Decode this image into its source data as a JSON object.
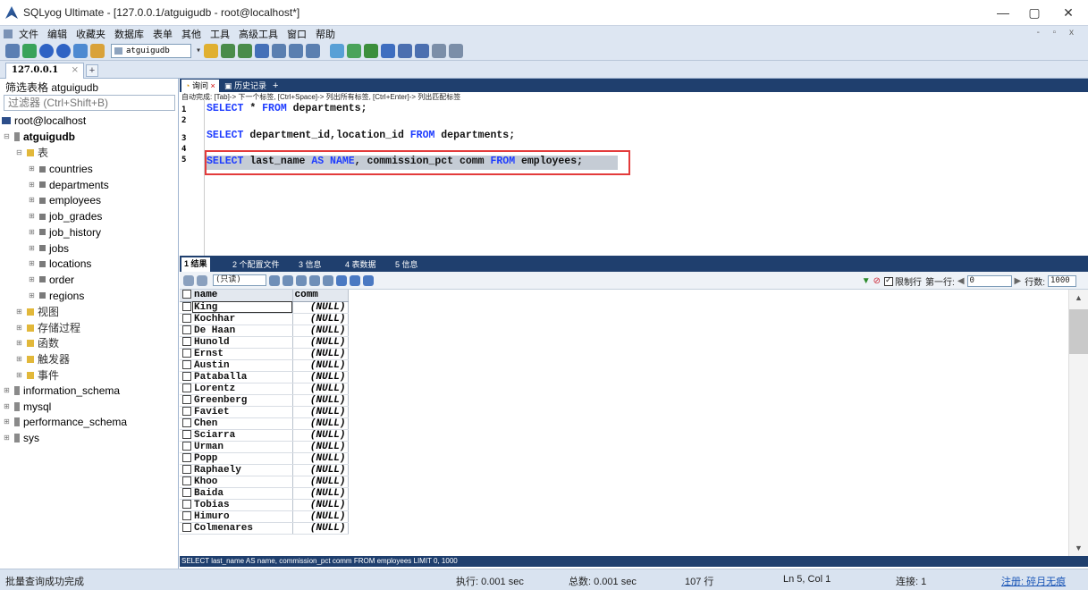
{
  "window": {
    "title": "SQLyog Ultimate - [127.0.0.1/atguigudb - root@localhost*]",
    "min_glyph": "—",
    "max_glyph": "▢",
    "close_glyph": "✕",
    "mdi_controls": "- ▫ x"
  },
  "menu": [
    "文件",
    "编辑",
    "收藏夹",
    "数据库",
    "表单",
    "其他",
    "工具",
    "高级工具",
    "窗口",
    "帮助"
  ],
  "toolbar": {
    "db_select": "atguigudb"
  },
  "connection_tab": {
    "label": "127.0.0.1",
    "close": "×",
    "add": "+"
  },
  "left": {
    "filter_label": "筛选表格 atguigudb",
    "filter_placeholder": "过滤器 (Ctrl+Shift+B)",
    "host": "root@localhost",
    "db": "atguigudb",
    "tables_folder": "表",
    "tables": [
      "countries",
      "departments",
      "employees",
      "job_grades",
      "job_history",
      "jobs",
      "locations",
      "order",
      "regions"
    ],
    "folders": [
      "视图",
      "存储过程",
      "函数",
      "触发器",
      "事件"
    ],
    "other_dbs": [
      "information_schema",
      "mysql",
      "performance_schema",
      "sys"
    ]
  },
  "editor": {
    "tab_query": "询问",
    "tab_history": "历史记录",
    "add_tab": "+",
    "autocomplete_hint": "自动完成: [Tab]-> 下一个标签, [Ctrl+Space]-> 列出所有标签, [Ctrl+Enter]-> 列出匹配标签",
    "line_numbers": [
      "1",
      "2",
      "3",
      "4",
      "5"
    ],
    "line1": {
      "a": "SELECT",
      "b": " * ",
      "c": "FROM",
      "d": " departments;"
    },
    "line3": {
      "a": "SELECT",
      "b": " department_id,location_id ",
      "c": "FROM",
      "d": " departments;"
    },
    "line5": {
      "a": "SELECT",
      "b": " last_name ",
      "c": "AS NAME",
      "d": ", commission_pct comm ",
      "e": "FROM",
      "f": " employees;"
    }
  },
  "result_tabs": [
    "1 结果",
    "2 个配置文件",
    "3 信息",
    "4 表数据",
    "5 信息"
  ],
  "result_toolbar": {
    "readonly": "(只读)",
    "limit_label": "限制行",
    "first_row_label": "第一行:",
    "first_row_value": "0",
    "rows_label": "行数:",
    "rows_value": "1000"
  },
  "grid": {
    "columns": [
      "name",
      "comm"
    ],
    "null_text": "(NULL)",
    "rows": [
      "King",
      "Kochhar",
      "De Haan",
      "Hunold",
      "Ernst",
      "Austin",
      "Pataballa",
      "Lorentz",
      "Greenberg",
      "Faviet",
      "Chen",
      "Sciarra",
      "Urman",
      "Popp",
      "Raphaely",
      "Khoo",
      "Baida",
      "Tobias",
      "Himuro",
      "Colmenares"
    ]
  },
  "sql_status": "SELECT last_name AS name, commission_pct comm FROM employees LIMIT 0, 1000",
  "status": {
    "left": "批量查询成功完成",
    "exec": "执行: 0.001 sec",
    "total": "总数: 0.001 sec",
    "rows": "107 行",
    "pos": "Ln 5, Col 1",
    "conn": "连接: 1",
    "register": "注册: 碎月无痕"
  },
  "colors": {
    "accent_dark": "#1f3f6e",
    "keyword": "#1e3cff",
    "highlight_box": "#e33b3b"
  }
}
